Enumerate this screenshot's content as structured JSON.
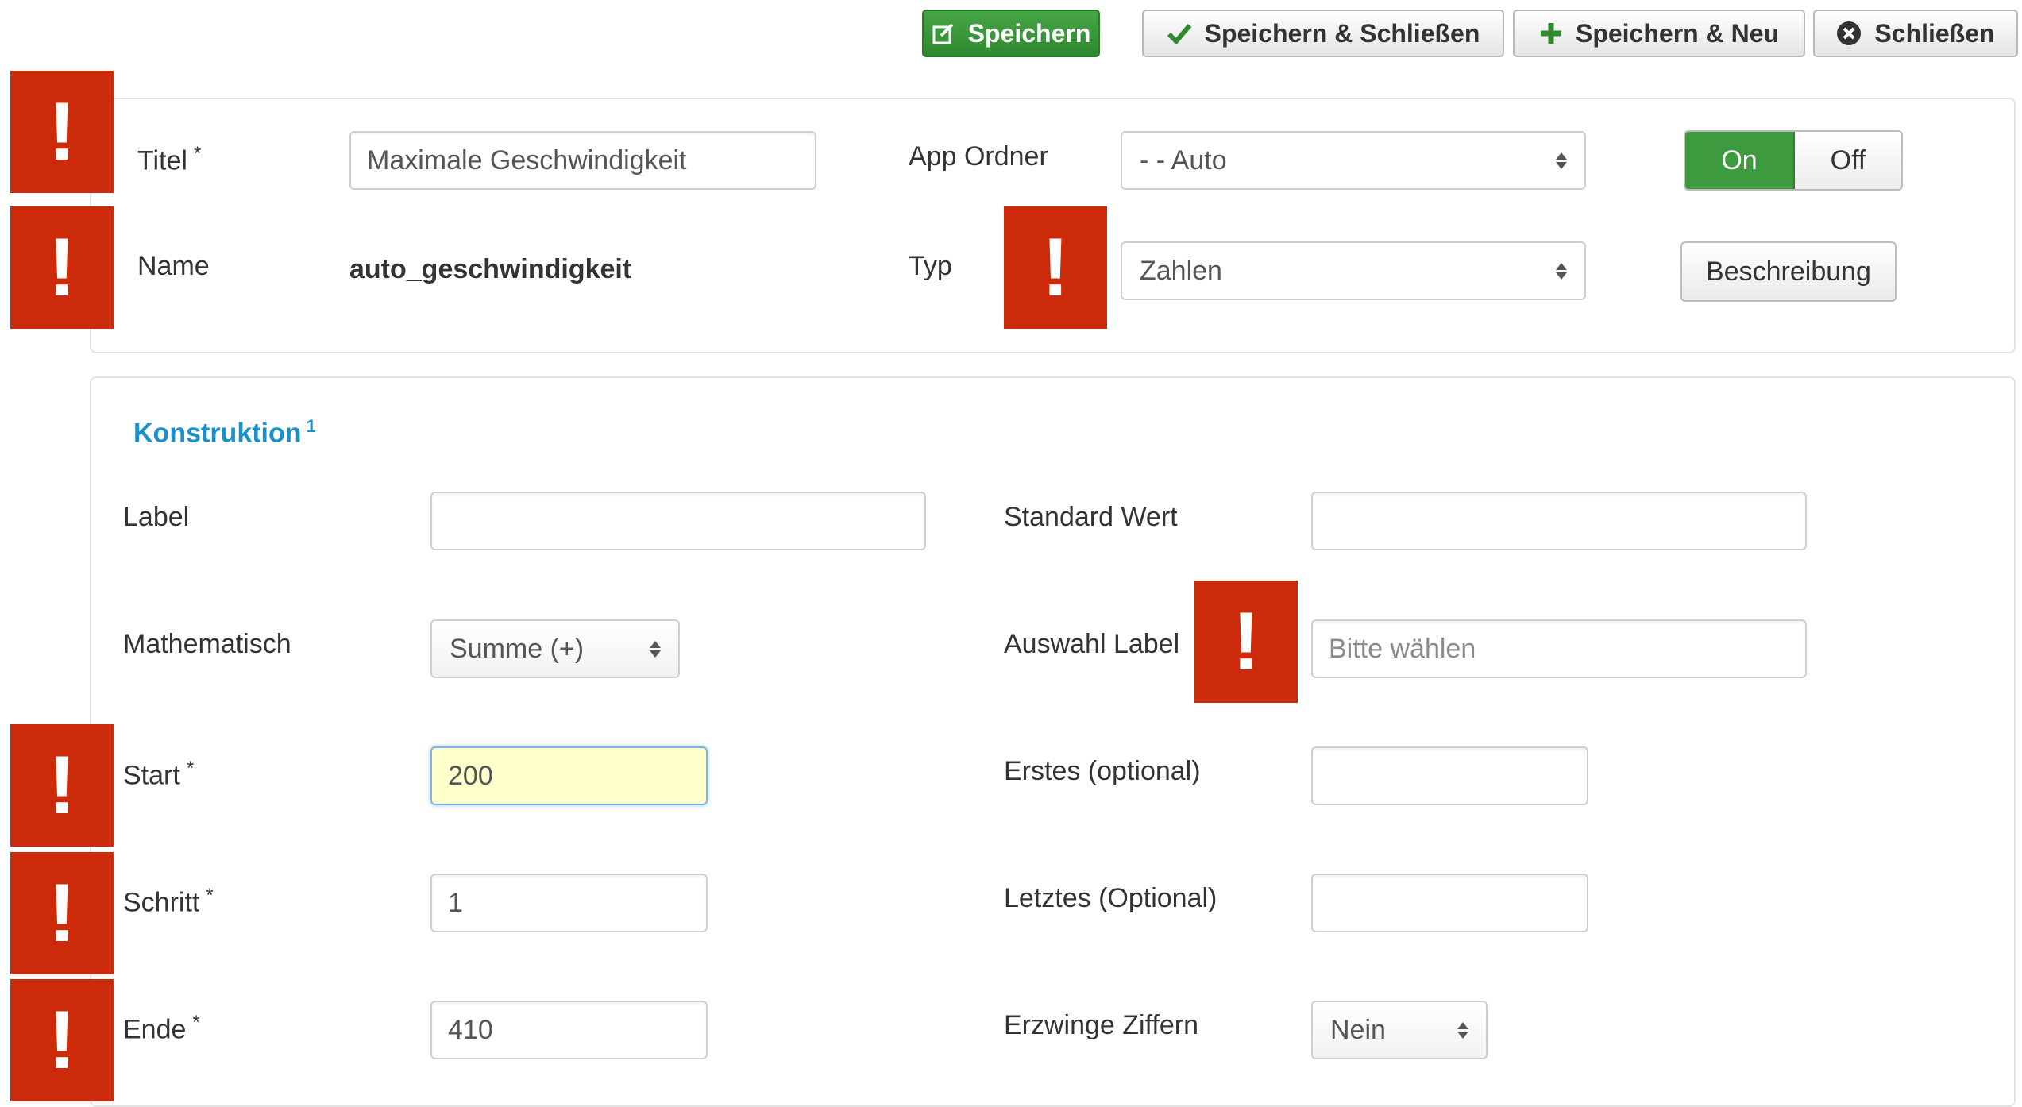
{
  "toolbar": {
    "save": "Speichern",
    "save_close": "Speichern & Schließen",
    "save_new": "Speichern & Neu",
    "close": "Schließen"
  },
  "header": {
    "title_label": "Titel",
    "title_value": "Maximale Geschwindigkeit",
    "name_label": "Name",
    "name_value": "auto_geschwindigkeit",
    "app_folder_label": "App Ordner",
    "app_folder_value": "- - Auto",
    "type_label": "Typ",
    "type_value": "Zahlen",
    "toggle_on": "On",
    "toggle_off": "Off",
    "toggle_state": "On",
    "description_button": "Beschreibung"
  },
  "section": {
    "title": "Konstruktion",
    "badge": "1"
  },
  "fields": {
    "label_label": "Label",
    "label_value": "",
    "default_label": "Standard Wert",
    "default_value": "",
    "math_label": "Mathematisch",
    "math_value": "Summe (+)",
    "select_label_label": "Auswahl Label",
    "select_label_placeholder": "Bitte wählen",
    "start_label": "Start",
    "start_value": "200",
    "first_label": "Erstes (optional)",
    "first_value": "",
    "step_label": "Schritt",
    "step_value": "1",
    "last_label": "Letztes (Optional)",
    "last_value": "",
    "end_label": "Ende",
    "end_value": "410",
    "force_digits_label": "Erzwinge Ziffern",
    "force_digits_value": "Nein"
  },
  "required_marker": "*",
  "warning_glyph": "!",
  "colors": {
    "primary_green": "#3e9a3e",
    "warning_red": "#cc2b0b",
    "section_blue": "#1a8fc9",
    "focus_bg": "#ffffcc"
  }
}
